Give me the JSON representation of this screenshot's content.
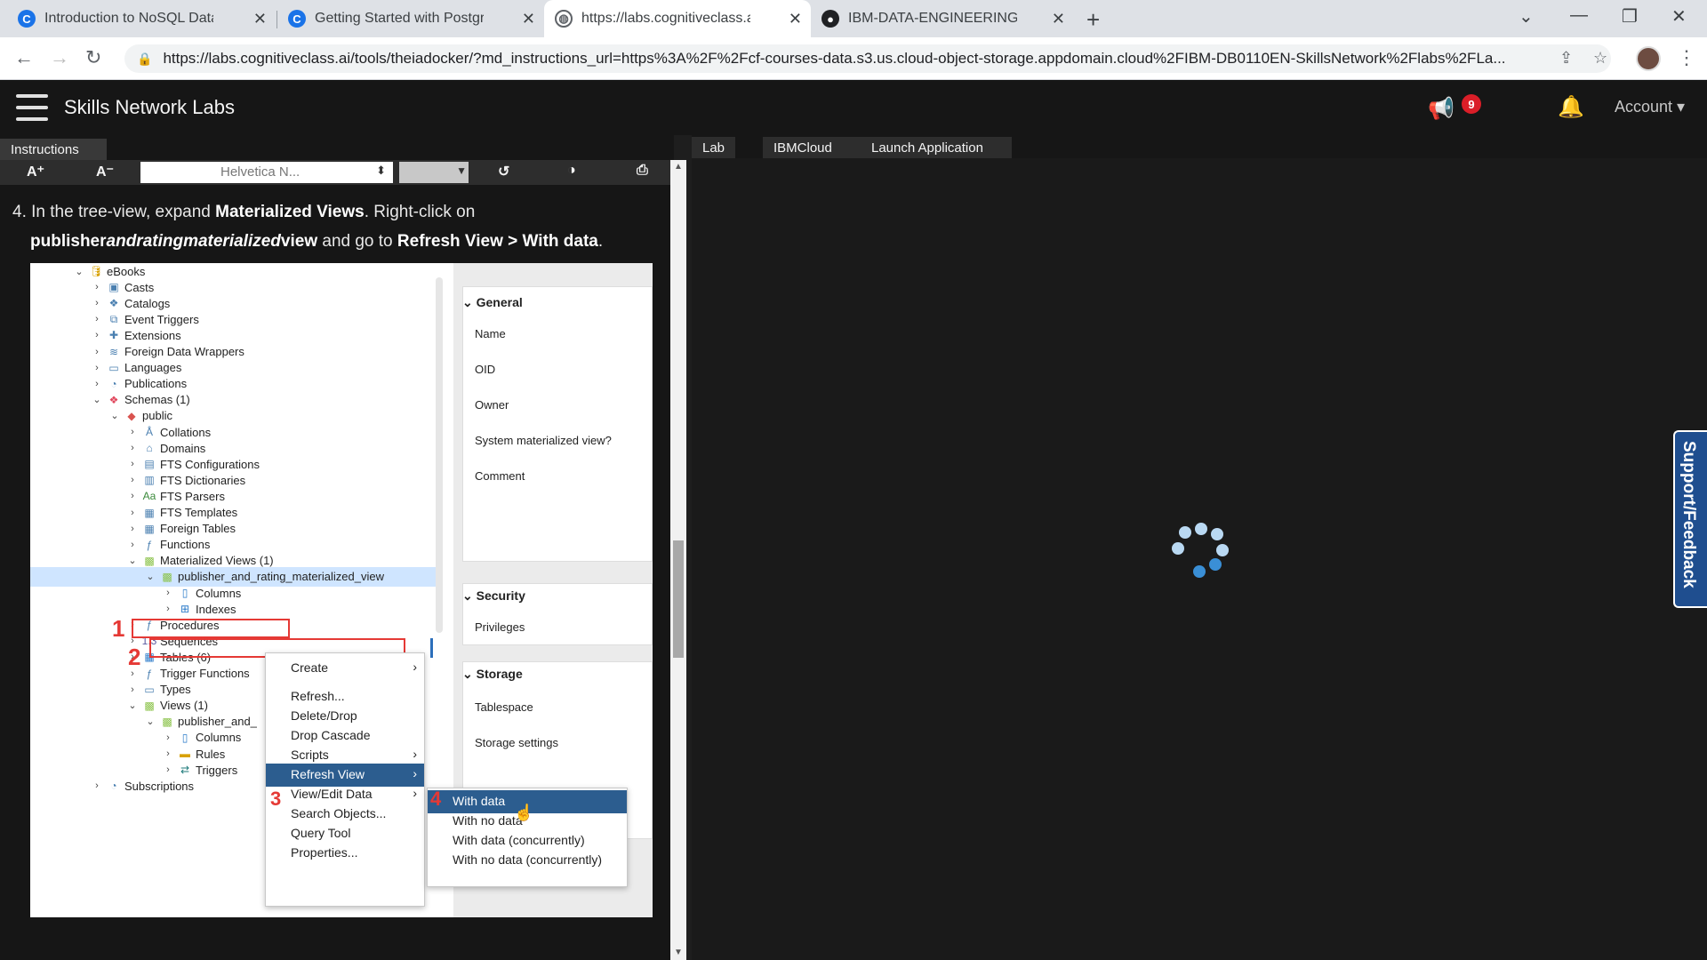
{
  "browser": {
    "tabs": [
      {
        "title": "Introduction to NoSQL Databas",
        "icon": "C"
      },
      {
        "title": "Getting Started with PostgreSQ",
        "icon": "C"
      },
      {
        "title": "https://labs.cognitiveclass.ai/too",
        "icon": "globe"
      },
      {
        "title": "IBM-DATA-ENGINEERING/Introd",
        "icon": "github"
      }
    ],
    "url": "https://labs.cognitiveclass.ai/tools/theiadocker/?md_instructions_url=https%3A%2F%2Fcf-courses-data.s3.us.cloud-object-storage.appdomain.cloud%2FIBM-DB0110EN-SkillsNetwork%2Flabs%2FLa..."
  },
  "header": {
    "brand": "Skills Network Labs",
    "notification_count": "9",
    "account_label": "Account"
  },
  "left": {
    "tab_label": "Instructions",
    "toolbar": {
      "increase_font": "A⁺",
      "decrease_font": "A⁻",
      "font_name": "Helvetica N..."
    },
    "step_prefix": "4. In the tree-view, expand ",
    "step_bold1": "Materialized Views",
    "step_mid": ". Right-click on",
    "step_bold2_a": "publisher",
    "step_bold2_b": "andrating",
    "step_bold2_c": "materialized",
    "step_bold2_d": "view",
    "step_mid2": " and go to ",
    "step_bold3": "Refresh View > With data",
    "step_end": "."
  },
  "tree": [
    {
      "label": "eBooks",
      "depth": 0,
      "expanded": true,
      "icon": "database-icon"
    },
    {
      "label": "Casts",
      "depth": 1,
      "expanded": false,
      "icon": "cast-icon"
    },
    {
      "label": "Catalogs",
      "depth": 1,
      "expanded": false,
      "icon": "catalog-icon"
    },
    {
      "label": "Event Triggers",
      "depth": 1,
      "expanded": false,
      "icon": "event-trigger-icon"
    },
    {
      "label": "Extensions",
      "depth": 1,
      "expanded": false,
      "icon": "extension-icon"
    },
    {
      "label": "Foreign Data Wrappers",
      "depth": 1,
      "expanded": false,
      "icon": "foreign-data-wrapper-icon"
    },
    {
      "label": "Languages",
      "depth": 1,
      "expanded": false,
      "icon": "language-icon"
    },
    {
      "label": "Publications",
      "depth": 1,
      "expanded": false,
      "icon": "publication-icon"
    },
    {
      "label": "Schemas (1)",
      "depth": 1,
      "expanded": true,
      "icon": "schema-icon"
    },
    {
      "label": "public",
      "depth": 2,
      "expanded": true,
      "icon": "public-schema-icon"
    },
    {
      "label": "Collations",
      "depth": 3,
      "expanded": false,
      "icon": "collation-icon"
    },
    {
      "label": "Domains",
      "depth": 3,
      "expanded": false,
      "icon": "domain-icon"
    },
    {
      "label": "FTS Configurations",
      "depth": 3,
      "expanded": false,
      "icon": "fts-config-icon"
    },
    {
      "label": "FTS Dictionaries",
      "depth": 3,
      "expanded": false,
      "icon": "fts-dictionary-icon"
    },
    {
      "label": "FTS Parsers",
      "depth": 3,
      "expanded": false,
      "icon": "fts-parser-icon"
    },
    {
      "label": "FTS Templates",
      "depth": 3,
      "expanded": false,
      "icon": "fts-template-icon"
    },
    {
      "label": "Foreign Tables",
      "depth": 3,
      "expanded": false,
      "icon": "foreign-table-icon"
    },
    {
      "label": "Functions",
      "depth": 3,
      "expanded": false,
      "icon": "function-icon"
    },
    {
      "label": "Materialized Views (1)",
      "depth": 3,
      "expanded": true,
      "icon": "materialized-view-icon"
    },
    {
      "label": "publisher_and_rating_materialized_view",
      "depth": 4,
      "expanded": true,
      "icon": "materialized-view-icon",
      "selected": true
    },
    {
      "label": "Columns",
      "depth": 5,
      "expanded": false,
      "icon": "columns-icon"
    },
    {
      "label": "Indexes",
      "depth": 5,
      "expanded": false,
      "icon": "indexes-icon"
    },
    {
      "label": "Procedures",
      "depth": 3,
      "expanded": false,
      "icon": "procedure-icon"
    },
    {
      "label": "Sequences",
      "depth": 3,
      "expanded": false,
      "icon": "sequence-icon"
    },
    {
      "label": "Tables (6)",
      "depth": 3,
      "expanded": false,
      "icon": "table-icon"
    },
    {
      "label": "Trigger Functions",
      "depth": 3,
      "expanded": false,
      "icon": "trigger-function-icon"
    },
    {
      "label": "Types",
      "depth": 3,
      "expanded": false,
      "icon": "type-icon"
    },
    {
      "label": "Views (1)",
      "depth": 3,
      "expanded": true,
      "icon": "view-icon"
    },
    {
      "label": "publisher_and_",
      "depth": 4,
      "expanded": true,
      "icon": "view-icon"
    },
    {
      "label": "Columns",
      "depth": 5,
      "expanded": false,
      "icon": "columns-icon"
    },
    {
      "label": "Rules",
      "depth": 5,
      "expanded": false,
      "icon": "rules-icon"
    },
    {
      "label": "Triggers",
      "depth": 5,
      "expanded": false,
      "icon": "triggers-icon"
    },
    {
      "label": "Subscriptions",
      "depth": 1,
      "expanded": false,
      "icon": "subscription-icon"
    }
  ],
  "properties": {
    "general_title": "General",
    "general_rows": [
      "Name",
      "OID",
      "Owner",
      "System materialized view?",
      "Comment"
    ],
    "security_title": "Security",
    "security_rows": [
      "Privileges"
    ],
    "storage_title": "Storage",
    "storage_rows": [
      "Tablespace",
      "Storage settings"
    ]
  },
  "context_menu": [
    {
      "label": "Create",
      "submenu": true
    },
    {
      "label": "Refresh...",
      "submenu": false
    },
    {
      "label": "Delete/Drop",
      "submenu": false
    },
    {
      "label": "Drop Cascade",
      "submenu": false
    },
    {
      "label": "Scripts",
      "submenu": true
    },
    {
      "label": "Refresh View",
      "submenu": true,
      "highlighted": true
    },
    {
      "label": "View/Edit Data",
      "submenu": true
    },
    {
      "label": "Search Objects...",
      "submenu": false
    },
    {
      "label": "Query Tool",
      "submenu": false
    },
    {
      "label": "Properties...",
      "submenu": false
    }
  ],
  "refresh_submenu": [
    {
      "label": "With data",
      "highlighted": true
    },
    {
      "label": "With no data"
    },
    {
      "label": "With data (concurrently)"
    },
    {
      "label": "With no data (concurrently)"
    }
  ],
  "annotations": [
    "1",
    "2",
    "3",
    "4"
  ],
  "right": {
    "tabs": [
      "Lab",
      "IBMCloud",
      "Launch Application"
    ],
    "feedback_label": "Support/Feedback"
  },
  "colors": {
    "accent_blue": "#2c5d8f",
    "annotation_red": "#e53935",
    "selection": "#cfe5ff"
  }
}
